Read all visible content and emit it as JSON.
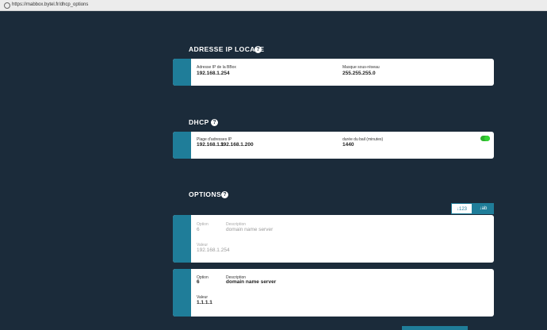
{
  "browser": {
    "url": "https://mabbox.bytel.fr/dhcp_options"
  },
  "local_ip": {
    "title": "ADRESSE IP LOCALE",
    "help": "?",
    "bbox_ip_label": "Adresse IP de la BBox",
    "bbox_ip_value": "192.168.1.254",
    "mask_label": "Masque sous-réseau",
    "mask_value": "255.255.255.0"
  },
  "dhcp": {
    "title": "DHCP",
    "help": "?",
    "range_label": "Plage d'adresses IP",
    "range_start": "192.168.1.1",
    "range_end": "192.168.1.200",
    "lease_label": "durée du bail (minutes)",
    "lease_value": "1440",
    "enabled": true,
    "toggle_color": "#2db32d"
  },
  "options": {
    "title": "OPTIONS",
    "help": "?",
    "sort_numeric": "↓123",
    "sort_alpha": "↓ab",
    "option_label": "Option",
    "description_label": "Description",
    "value_label": "Valeur",
    "items": [
      {
        "option": "6",
        "description": "domain name server",
        "value": "192.168.1.254",
        "editable": false
      },
      {
        "option": "6",
        "description": "domain name server",
        "value": "1.1.1.1",
        "editable": true
      }
    ]
  },
  "colors": {
    "background": "#1b2b3a",
    "accent": "#1f7d99",
    "card": "#ffffff"
  }
}
